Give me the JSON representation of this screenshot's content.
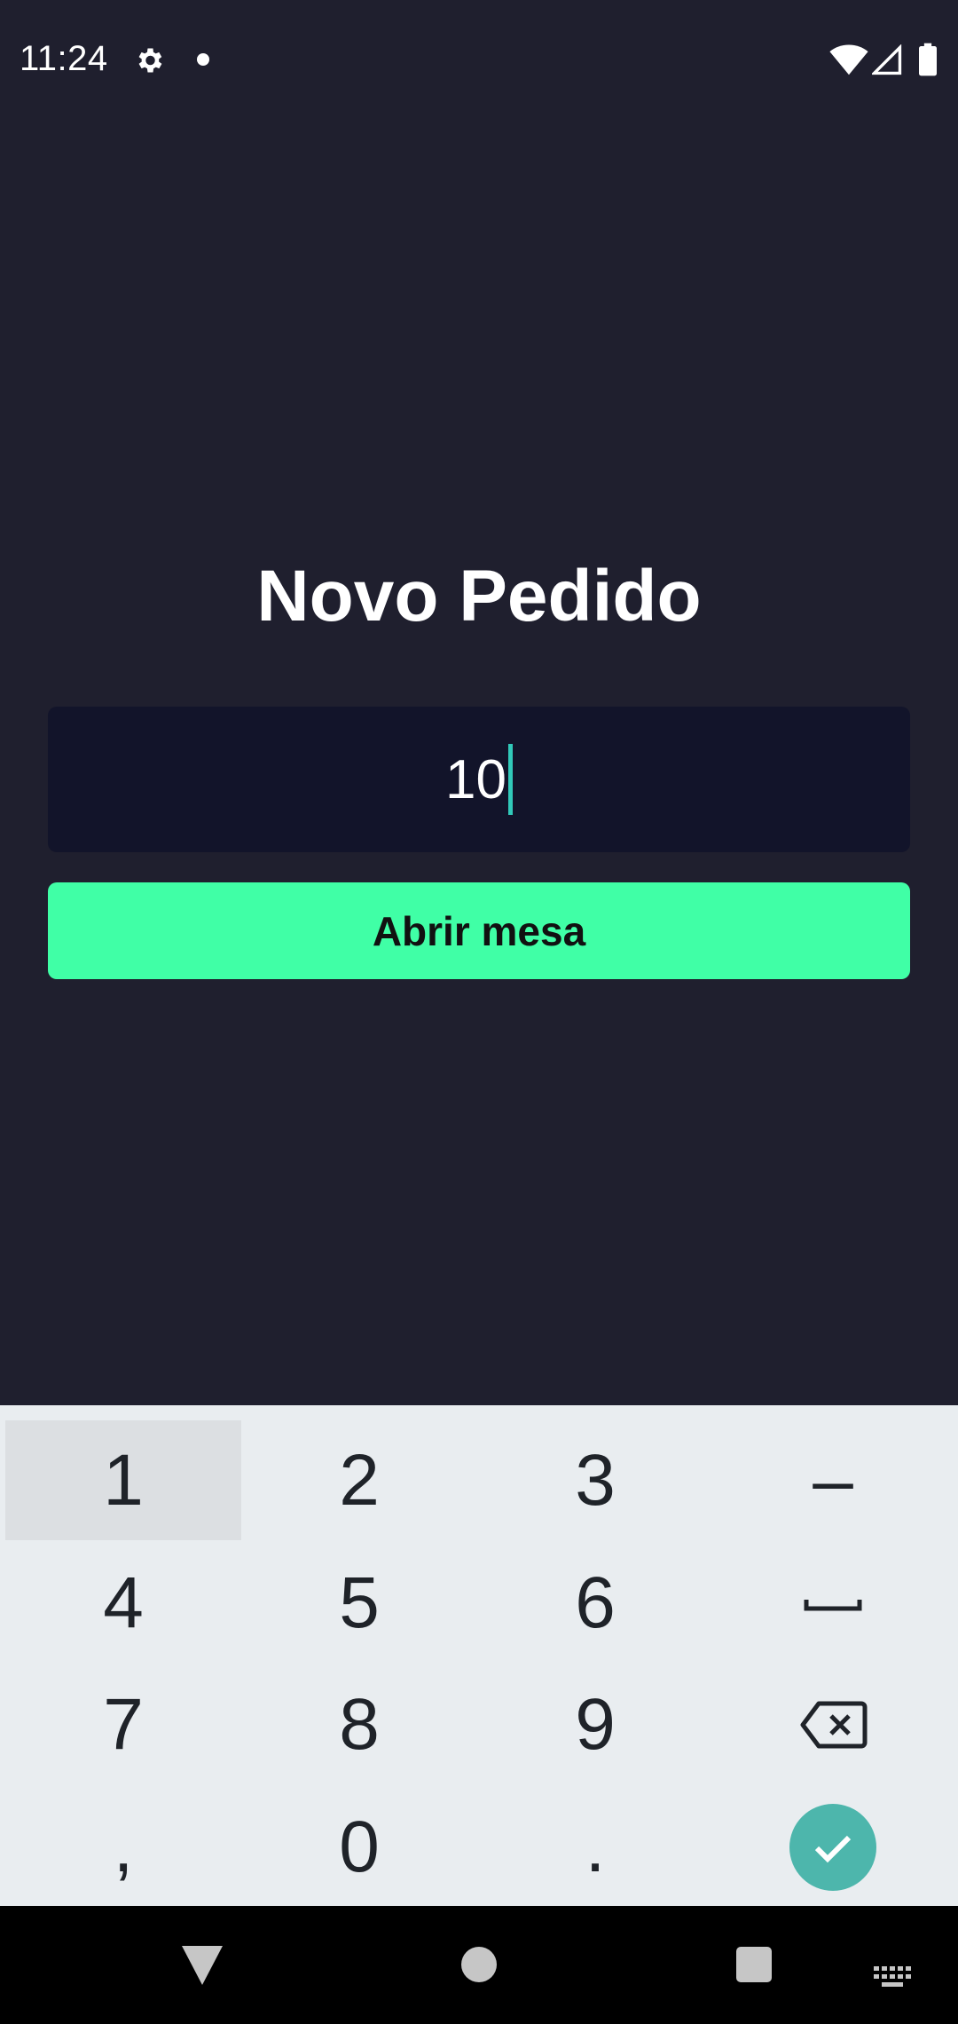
{
  "status_bar": {
    "time": "11:24",
    "icons": [
      "gear-icon",
      "notification-dot-icon",
      "wifi-icon",
      "signal-icon",
      "battery-icon"
    ]
  },
  "main": {
    "title": "Novo Pedido",
    "table_input": {
      "value": "10"
    },
    "open_button_label": "Abrir mesa"
  },
  "keyboard": {
    "rows": [
      [
        "1",
        "2",
        "3",
        "–"
      ],
      [
        "4",
        "5",
        "6",
        "space-icon"
      ],
      [
        "7",
        "8",
        "9",
        "backspace-icon"
      ],
      [
        ",",
        "0",
        ".",
        "done-check-icon"
      ]
    ],
    "pressed_key": "1",
    "done_key_color": "#4db6ac"
  },
  "nav_bar": {
    "icons": [
      "back-icon",
      "home-icon",
      "recents-icon",
      "keyboard-switch-icon"
    ]
  },
  "colors": {
    "background": "#1f1f2e",
    "input_background": "#12142a",
    "accent": "#40ffa6",
    "cursor": "#31c9b9",
    "keyboard_background": "#e9edf0"
  }
}
